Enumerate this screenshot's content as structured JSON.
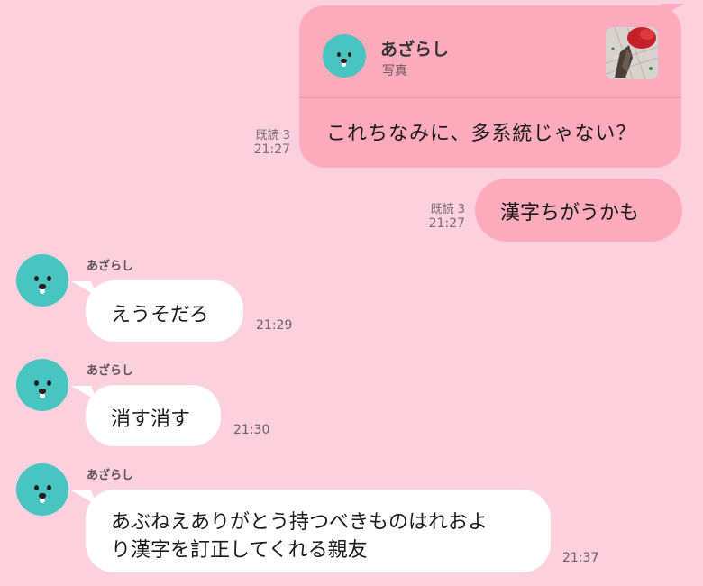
{
  "contact": {
    "name": "あざらし",
    "avatar_icon": "seal-icon",
    "avatar_color": "#48c4c1"
  },
  "messages": {
    "m1": {
      "quote_name": "あざらし",
      "quote_type": "写真",
      "text": "これちなみに、多系統じゃない？",
      "read": "既読 3",
      "time": "21:27"
    },
    "m2": {
      "text": "漢字ちがうかも",
      "read": "既読 3",
      "time": "21:27"
    },
    "m3": {
      "sender": "あざらし",
      "text": "えうそだろ",
      "time": "21:29"
    },
    "m4": {
      "sender": "あざらし",
      "text": "消す消す",
      "time": "21:30"
    },
    "m5": {
      "sender": "あざらし",
      "line1": "あぶねえありがとう持つべきものはれおよ",
      "line2": "り漢字を訂正してくれる親友",
      "time": "21:37"
    }
  },
  "colors": {
    "background": "#fcd0dd",
    "outgoing_bubble": "#fdaabd",
    "incoming_bubble": "#ffffff",
    "avatar": "#48c4c1"
  }
}
